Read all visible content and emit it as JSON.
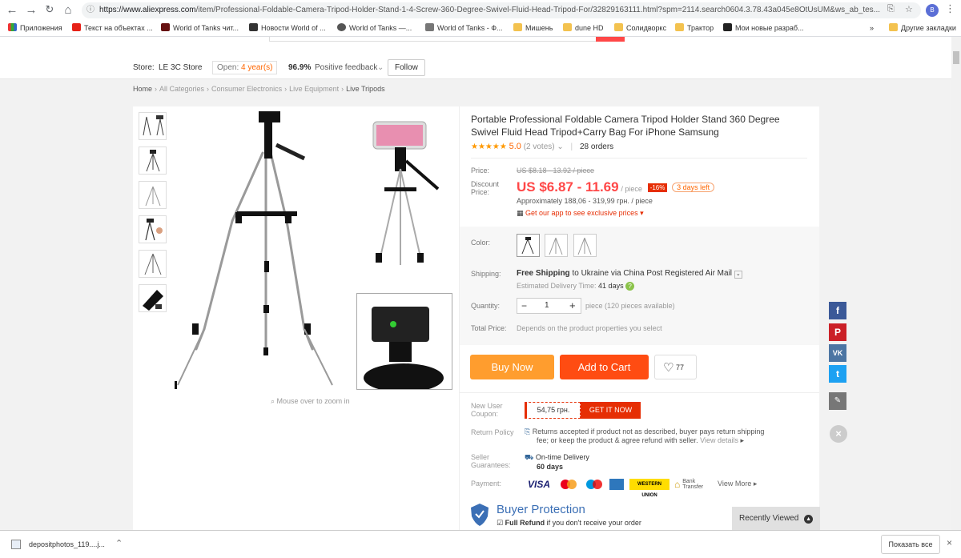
{
  "browser": {
    "url_domain": "https://www.aliexpress.com",
    "url_path": "/item/Professional-Foldable-Camera-Tripod-Holder-Stand-1-4-Screw-360-Degree-Swivel-Fluid-Head-Tripod-For/32829163111.html?spm=2114.search0604.3.78.43a045e8OtUsUM&ws_ab_tes...",
    "profile_initial": "B",
    "bookmarks": [
      "Приложения",
      "Текст на объектах ...",
      "World of Tanks чит...",
      "Новости World of ...",
      "World of Tanks —...",
      "World of Tanks - Ф...",
      "Мишень",
      "dune HD",
      "Солидворкс",
      "Трактор",
      "Мои новые разраб...",
      "»",
      "Другие закладки"
    ]
  },
  "store": {
    "label": "Store:",
    "name": "LE 3C Store",
    "open_label": "Open:",
    "open_years": "4 year(s)",
    "feedback_pct": "96.9%",
    "feedback_label": "Positive feedback",
    "follow": "Follow"
  },
  "breadcrumb": [
    "Home",
    "›",
    "All Categories",
    "›",
    "Consumer Electronics",
    "›",
    "Live Equipment",
    "›",
    "Live Tripods"
  ],
  "gallery": {
    "zoom_hint": "Mouse over to zoom in"
  },
  "product": {
    "title": "Portable Professional Foldable Camera Tripod Holder Stand 360 Degree Swivel Fluid Head Tripod+Carry Bag For iPhone Samsung",
    "stars": "★★★★★",
    "rating": "5.0",
    "votes": "(2 votes)",
    "orders": "28 orders",
    "price_label": "Price:",
    "orig_price": "US $8.18 - 13.92 / piece",
    "discount_label": "Discount Price:",
    "discount_price": "US $6.87 - 11.69",
    "per_piece": "/ piece",
    "discount_pct": "-16%",
    "days_left": "3 days left",
    "approx": "Approximately 188,06 - 319,99 грн. / piece",
    "app_link": "Get our app to see exclusive prices",
    "color_label": "Color:",
    "shipping_label": "Shipping:",
    "shipping_free": "Free Shipping",
    "shipping_to": "to",
    "shipping_country": "Ukraine",
    "shipping_via": "via",
    "shipping_carrier": "China Post Registered Air Mail",
    "delivery": "Estimated Delivery Time:",
    "delivery_days": "41  days",
    "qty_label": "Quantity:",
    "qty": "1",
    "qty_avail": "piece (120 pieces available)",
    "total_label": "Total Price:",
    "total_text": "Depends on the product properties you select",
    "buy_now": "Buy Now",
    "add_cart": "Add to Cart",
    "wish_count": "77",
    "coupon_label": "New User Coupon:",
    "coupon_value": "54,75 грн.",
    "coupon_btn": "GET IT NOW",
    "return_label": "Return Policy",
    "return_text1": "Returns accepted if product not as described, buyer pays return shipping",
    "return_text2": "fee; or keep the product & agree refund with seller.",
    "view_details": "View details",
    "guarantee_label": "Seller Guarantees:",
    "ontime": "On-time Delivery",
    "ontime_days": "60 days",
    "payment_label": "Payment:",
    "pay_visa": "VISA",
    "pay_wu": "WESTERN UNION",
    "pay_bank": "Bank Transfer",
    "view_more": "View More",
    "buyer_protection": "Buyer Protection",
    "full_refund": "Full Refund",
    "full_refund_text": "if you don't receive your order",
    "recently_viewed": "Recently Viewed"
  },
  "downloads": {
    "file": "depositphotos_119....j...",
    "show_all": "Показать все"
  },
  "colors": {
    "accent": "#ff4747",
    "buy": "#ff9d2e",
    "cart": "#ff4c12",
    "facebook": "#3b5998",
    "pinterest": "#cb2027",
    "vk": "#4c75a3",
    "twitter": "#1da1f2"
  }
}
